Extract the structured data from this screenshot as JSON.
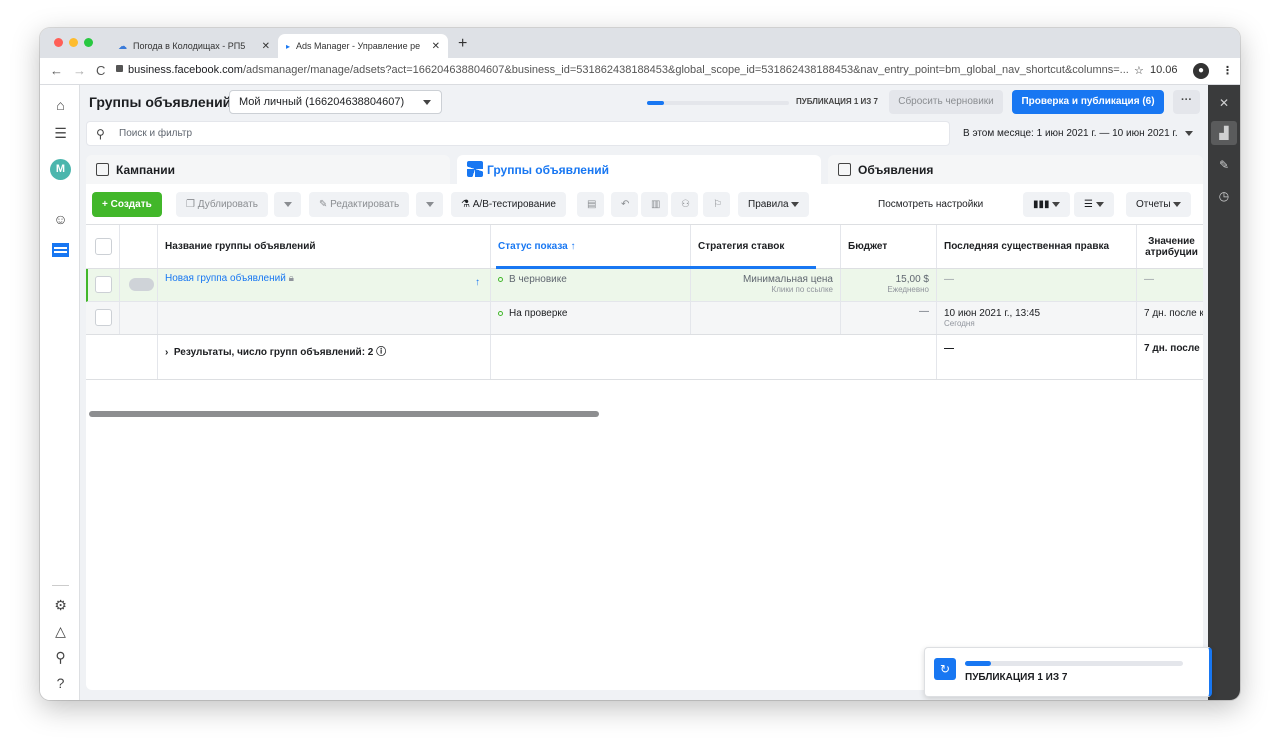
{
  "browser": {
    "tabs": [
      {
        "title": "Погода в Колодищах - РП5",
        "active": false
      },
      {
        "title": "Ads Manager - Управление ре",
        "active": true
      }
    ],
    "url_domain": "business.facebook.com",
    "url_path": "/adsmanager/manage/adsets?act=166204638804607&business_id=531862438188453&global_scope_id=531862438188453&nav_entry_point=bm_global_nav_shortcut&columns=...",
    "star_icon": "star-icon",
    "zoom_text": "10.06"
  },
  "header": {
    "title": "Группы объявлений",
    "account": "Мой личный (166204638804607)",
    "publish_status": "ПУБЛИКАЦИЯ 1 ИЗ 7",
    "publish_progress": 0.12,
    "reset_drafts": "Сбросить черновики",
    "review_publish": "Проверка и публикация (6)",
    "more": "···"
  },
  "search": {
    "placeholder": "Поиск и фильтр"
  },
  "date_range": "В этом месяце: 1 июн 2021 г. — 10 июн 2021 г.",
  "level_tabs": [
    {
      "label": "Кампании"
    },
    {
      "label": "Группы объявлений"
    },
    {
      "label": "Объявления"
    }
  ],
  "actions": {
    "create": "+  Создать",
    "duplicate": "Дублировать",
    "edit": "Редактировать",
    "ab_test": "А/В-тестирование",
    "rules": "Правила",
    "view_settings": "Посмотреть настройки",
    "reports": "Отчеты"
  },
  "table": {
    "columns": {
      "name": "Название группы объявлений",
      "status": "Статус показа ↑",
      "bid": "Стратегия ставок",
      "budget": "Бюджет",
      "last_edit": "Последняя существенная правка",
      "attribution": "Значение атрибуции"
    },
    "rows": [
      {
        "name": "Новая группа объявлений",
        "status": "В черновике",
        "bid": "Минимальная цена",
        "bid_sub": "Клики по ссылке",
        "budget": "15,00 $",
        "budget_sub": "Ежедневно",
        "last_edit": "—",
        "attribution": "—"
      },
      {
        "name": "",
        "status": "На проверке",
        "bid": "",
        "budget": "—",
        "last_edit": "10 июн 2021 г., 13:45",
        "last_edit_sub": "Сегодня",
        "attribution": "7 дн. после к"
      }
    ],
    "summary": {
      "label": "Результаты, число групп объявлений: 2",
      "last_edit": "—",
      "attribution": "7 дн. после"
    }
  },
  "publish_card": {
    "label": "ПУБЛИКАЦИЯ 1 ИЗ 7",
    "progress": 0.12
  }
}
